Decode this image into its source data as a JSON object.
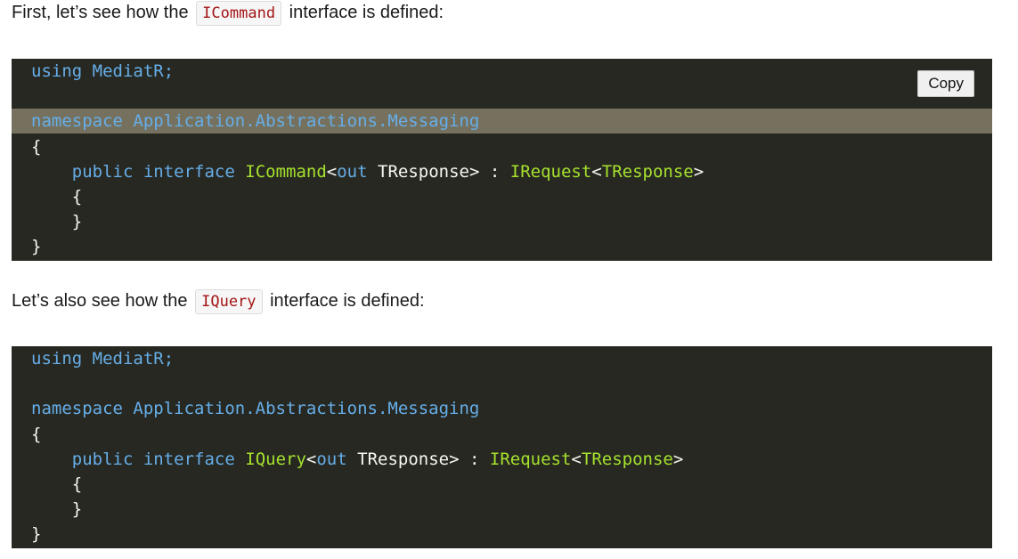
{
  "paragraph1": {
    "before": "First, let’s see how the",
    "code": "ICommand",
    "after": "interface is defined:"
  },
  "paragraph2": {
    "before": "Let’s also see how the",
    "code": "IQuery",
    "after": "interface is defined:"
  },
  "copy_button": {
    "label": "Copy"
  },
  "code1": {
    "using_kw": "using",
    "using_ns": "MediatR;",
    "namespace_kw": "namespace",
    "namespace_name": "Application.Abstractions.Messaging",
    "open_brace": "{",
    "public_kw": "public",
    "interface_kw": "interface",
    "interface_name": "ICommand",
    "lt": "<",
    "out_kw": "out",
    "tresponse": "TResponse",
    "gt": ">",
    "colon": ":",
    "base_name": "IRequest",
    "base_lt": "<",
    "base_tresponse": "TResponse",
    "base_gt": ">",
    "inner_open": "{",
    "inner_close": "}",
    "close_brace": "}"
  },
  "code2": {
    "using_kw": "using",
    "using_ns": "MediatR;",
    "namespace_kw": "namespace",
    "namespace_name": "Application.Abstractions.Messaging",
    "open_brace": "{",
    "public_kw": "public",
    "interface_kw": "interface",
    "interface_name": "IQuery",
    "lt": "<",
    "out_kw": "out",
    "tresponse": "TResponse",
    "gt": ">",
    "colon": ":",
    "base_name": "IRequest",
    "base_lt": "<",
    "base_tresponse": "TResponse",
    "base_gt": ">",
    "inner_open": "{",
    "inner_close": "}",
    "close_brace": "}"
  },
  "colors": {
    "code_background": "#272822",
    "highlight_line": "#75715e",
    "keyword": "#66aee8",
    "type": "#a6e22e",
    "inline_code_text": "#a31515"
  }
}
